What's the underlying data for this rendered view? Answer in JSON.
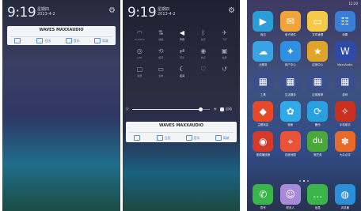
{
  "screen1": {
    "time": "9:19",
    "weekday": "星期四",
    "date": "2013-4-2",
    "brand": "MAXXAUDIO",
    "brand_prefix": "WAVES",
    "actions": [
      {
        "icon": "clock-icon",
        "label": ""
      },
      {
        "icon": "calendar-icon",
        "label": "日历"
      },
      {
        "icon": "music-icon",
        "label": "音乐"
      },
      {
        "icon": "car-icon",
        "label": "驾驶"
      }
    ]
  },
  "screen2": {
    "time": "9:19",
    "weekday": "星期四",
    "date": "2013-4-2",
    "toggles": [
      {
        "icon": "wifi-icon",
        "label": "Portable",
        "on": false
      },
      {
        "icon": "data-icon",
        "label": "数据",
        "on": false
      },
      {
        "icon": "volume-icon",
        "label": "声音",
        "on": true
      },
      {
        "icon": "bluetooth-icon",
        "label": "蓝牙",
        "on": false
      },
      {
        "icon": "airplane-icon",
        "label": "飞行",
        "on": false
      },
      {
        "icon": "gps-icon",
        "label": "GPS",
        "on": false
      },
      {
        "icon": "rotate-icon",
        "label": "旋转",
        "on": false
      },
      {
        "icon": "sync-icon",
        "label": "同步",
        "on": false
      },
      {
        "icon": "hotspot-icon",
        "label": "热点",
        "on": false
      },
      {
        "icon": "screenshot-icon",
        "label": "截屏",
        "on": false
      },
      {
        "icon": "lock-icon",
        "label": "锁屏",
        "on": false
      },
      {
        "icon": "battery-icon",
        "label": "省电",
        "on": false
      },
      {
        "icon": "moon-icon",
        "label": "夜间",
        "on": true
      },
      {
        "icon": "heart-icon",
        "label": "",
        "on": false
      },
      {
        "icon": "back-icon",
        "label": "",
        "on": false
      }
    ],
    "brightness": 0.88,
    "auto_label": "自动",
    "brand": "MAXXAUDIO",
    "brand_prefix": "WAVES",
    "actions": [
      {
        "icon": "clock-icon",
        "label": ""
      },
      {
        "icon": "calendar-icon",
        "label": "日历"
      },
      {
        "icon": "music-icon",
        "label": "音乐"
      },
      {
        "icon": "car-icon",
        "label": "驾驶"
      }
    ]
  },
  "screen3": {
    "status_left": "",
    "status_right": "12:20",
    "apps": [
      {
        "name": "商店",
        "icon": "play-store-icon",
        "color": "#2a9ed8",
        "glyph": "▶"
      },
      {
        "name": "电子邮件",
        "icon": "email-icon",
        "color": "#f2a33a",
        "glyph": "✉"
      },
      {
        "name": "文件管理",
        "icon": "folder-icon",
        "color": "#f6c94a",
        "glyph": "▭"
      },
      {
        "name": "设置",
        "icon": "settings-icon",
        "color": "#3b7ed8",
        "glyph": "☷"
      },
      {
        "name": "云服务",
        "icon": "cloud-icon",
        "color": "#3aa3e6",
        "glyph": "☁"
      },
      {
        "name": "用户中心",
        "icon": "user-center-icon",
        "color": "#2f8fe0",
        "glyph": "✦"
      },
      {
        "name": "应用中心",
        "icon": "app-center-icon",
        "color": "#e0a42a",
        "glyph": "★"
      },
      {
        "name": "MaxxAudio",
        "icon": "audio-wave-icon",
        "color": "#2e4aa8",
        "glyph": "W"
      },
      {
        "name": "工具",
        "icon": "tools-folder-icon",
        "color": "#3a4f8a",
        "glyph": "▦"
      },
      {
        "name": "生活服务",
        "icon": "life-folder-icon",
        "color": "#3a4f8a",
        "glyph": "▦"
      },
      {
        "name": "应用推荐",
        "icon": "recommend-folder-icon",
        "color": "#3a4f8a",
        "glyph": "▦"
      },
      {
        "name": "游戏",
        "icon": "games-folder-icon",
        "color": "#3a4f8a",
        "glyph": "▦"
      },
      {
        "name": "主题商店",
        "icon": "theme-icon",
        "color": "#e44a2a",
        "glyph": "◆"
      },
      {
        "name": "相册",
        "icon": "gallery-icon",
        "color": "#2fa9e8",
        "glyph": "✿"
      },
      {
        "name": "备份",
        "icon": "backup-icon",
        "color": "#29a0e0",
        "glyph": "⟳"
      },
      {
        "name": "手机助手",
        "icon": "assistant-icon",
        "color": "#c83020",
        "glyph": "✧"
      },
      {
        "name": "视频播放器",
        "icon": "video-icon",
        "color": "#d43a2a",
        "glyph": "◉"
      },
      {
        "name": "百度地图",
        "icon": "map-icon",
        "color": "#e8533a",
        "glyph": "⌖"
      },
      {
        "name": "豌豆荚",
        "icon": "wandoujia-icon",
        "color": "#4aa83a",
        "glyph": "du"
      },
      {
        "name": "大众点评",
        "icon": "dianping-icon",
        "color": "#e86a2a",
        "glyph": "✽"
      }
    ],
    "dock": [
      {
        "name": "拨号",
        "icon": "phone-icon",
        "color": "#3ab54a",
        "glyph": "✆"
      },
      {
        "name": "联系人",
        "icon": "contacts-icon",
        "color": "#a88ad8",
        "glyph": "☺"
      },
      {
        "name": "信息",
        "icon": "messages-icon",
        "color": "#3ab54a",
        "glyph": "…"
      },
      {
        "name": "浏览器",
        "icon": "browser-icon",
        "color": "#2a8fd8",
        "glyph": "◍"
      }
    ]
  }
}
